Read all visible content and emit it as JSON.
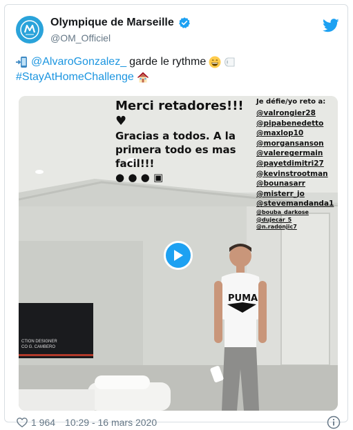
{
  "account": {
    "display_name": "Olympique de Marseille",
    "handle": "@OM_Officiel",
    "avatar_icon": "om-logo-icon",
    "verified_icon": "verified-badge-icon",
    "brand_color": "#2aa3da"
  },
  "platform_icon": "twitter-bird-icon",
  "tweet": {
    "mention": "@AlvaroGonzalez_",
    "text_after_mention": "garde le rythme",
    "hashtag": "#StayAtHomeChallenge",
    "link_color": "#1b95e0"
  },
  "media": {
    "headline": "Merci retadores!!!",
    "subline": "Gracias a todos. A la primera todo es mas facil!!!",
    "challenge_header": "Je défie/yo reto a:",
    "challenged": [
      "@valrongier28",
      "@pipabenedetto",
      "@maxlop10",
      "@morgansanson",
      "@valeregermain",
      "@payetdimitri27",
      "@kevinstrootman",
      "@bounasarr",
      "@misterr_jo",
      "@stevemandanda1"
    ],
    "challenged_small": [
      "@bouba_darkose",
      "@dujecar_5",
      "@n.radonjic7"
    ],
    "tv_caption": "CTION DESIGNER\nCO G. CAMBERO",
    "shirt_brand": "PUMA",
    "play_icon": "play-icon"
  },
  "footer": {
    "likes": "1 964",
    "timestamp": "10:29 - 16 mars 2020",
    "heart_icon": "heart-icon",
    "info_icon": "info-icon"
  }
}
